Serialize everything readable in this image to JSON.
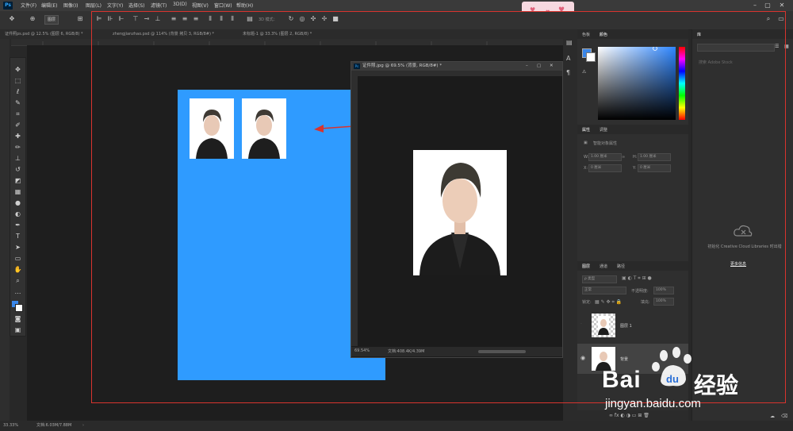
{
  "menubar": {
    "logo": "Ps",
    "items": [
      "文件(F)",
      "编辑(E)",
      "图像(I)",
      "图层(L)",
      "文字(Y)",
      "选择(S)",
      "滤镜(T)",
      "3D(D)",
      "视图(V)",
      "窗口(W)",
      "帮助(H)"
    ],
    "window_controls": [
      "–",
      "▢",
      "✕"
    ]
  },
  "options_bar": {
    "layer_select": "图层",
    "mode_3d": "3D 模式："
  },
  "document_tabs": [
    "证件照ps.psd @ 12.5% (图层 6, RGB/8) *",
    "zhengjianzhao.psd @ 114% (背景 拷贝 3, RGB/8#) *",
    "未标题-1 @ 33.3% (图层 2, RGB/8) *"
  ],
  "floating_window": {
    "icon": "Ps",
    "title": "证件照.jpg @ 69.5% (背景, RGB/8#) *",
    "zoom": "69.54%",
    "doc_info": "文档:408.4K/4.39M"
  },
  "status_bar": {
    "zoom": "33.33%",
    "doc_info": "文档:6.03M/7.88M"
  },
  "color_panel": {
    "tabs": [
      "色板",
      "颜色"
    ],
    "fg_color": "#3a86e8",
    "bg_color": "#ffffff"
  },
  "properties_panel": {
    "tabs": [
      "属性",
      "调整"
    ],
    "section": "智能对象属性",
    "w_label": "W:",
    "w_value": "1.00 厘米",
    "h_label": "H:",
    "h_value": "1.00 厘米",
    "x_label": "X:",
    "x_value": "0 厘米",
    "y_label": "Y:",
    "y_value": "0 厘米"
  },
  "libraries_panel": {
    "tab": "库",
    "search_placeholder": "搜索 Adobe Stock",
    "message": "初始化 Creative Cloud Libraries 时出错",
    "link": "更多信息"
  },
  "layers_panel": {
    "tabs": [
      "图层",
      "通道",
      "路径"
    ],
    "filter_label": "ρ 类型",
    "blend_mode": "正常",
    "opacity_label": "不透明度:",
    "opacity_value": "100%",
    "lock_label": "锁定:",
    "fill_label": "填充:",
    "fill_value": "100%",
    "layers": [
      {
        "name": "图层 1",
        "visible": false
      },
      {
        "name": "背景",
        "visible": true
      }
    ]
  },
  "watermark": {
    "brand": "Bai",
    "brand_du": "du",
    "cn": "经验",
    "url": "jingyan.baidu.com"
  }
}
